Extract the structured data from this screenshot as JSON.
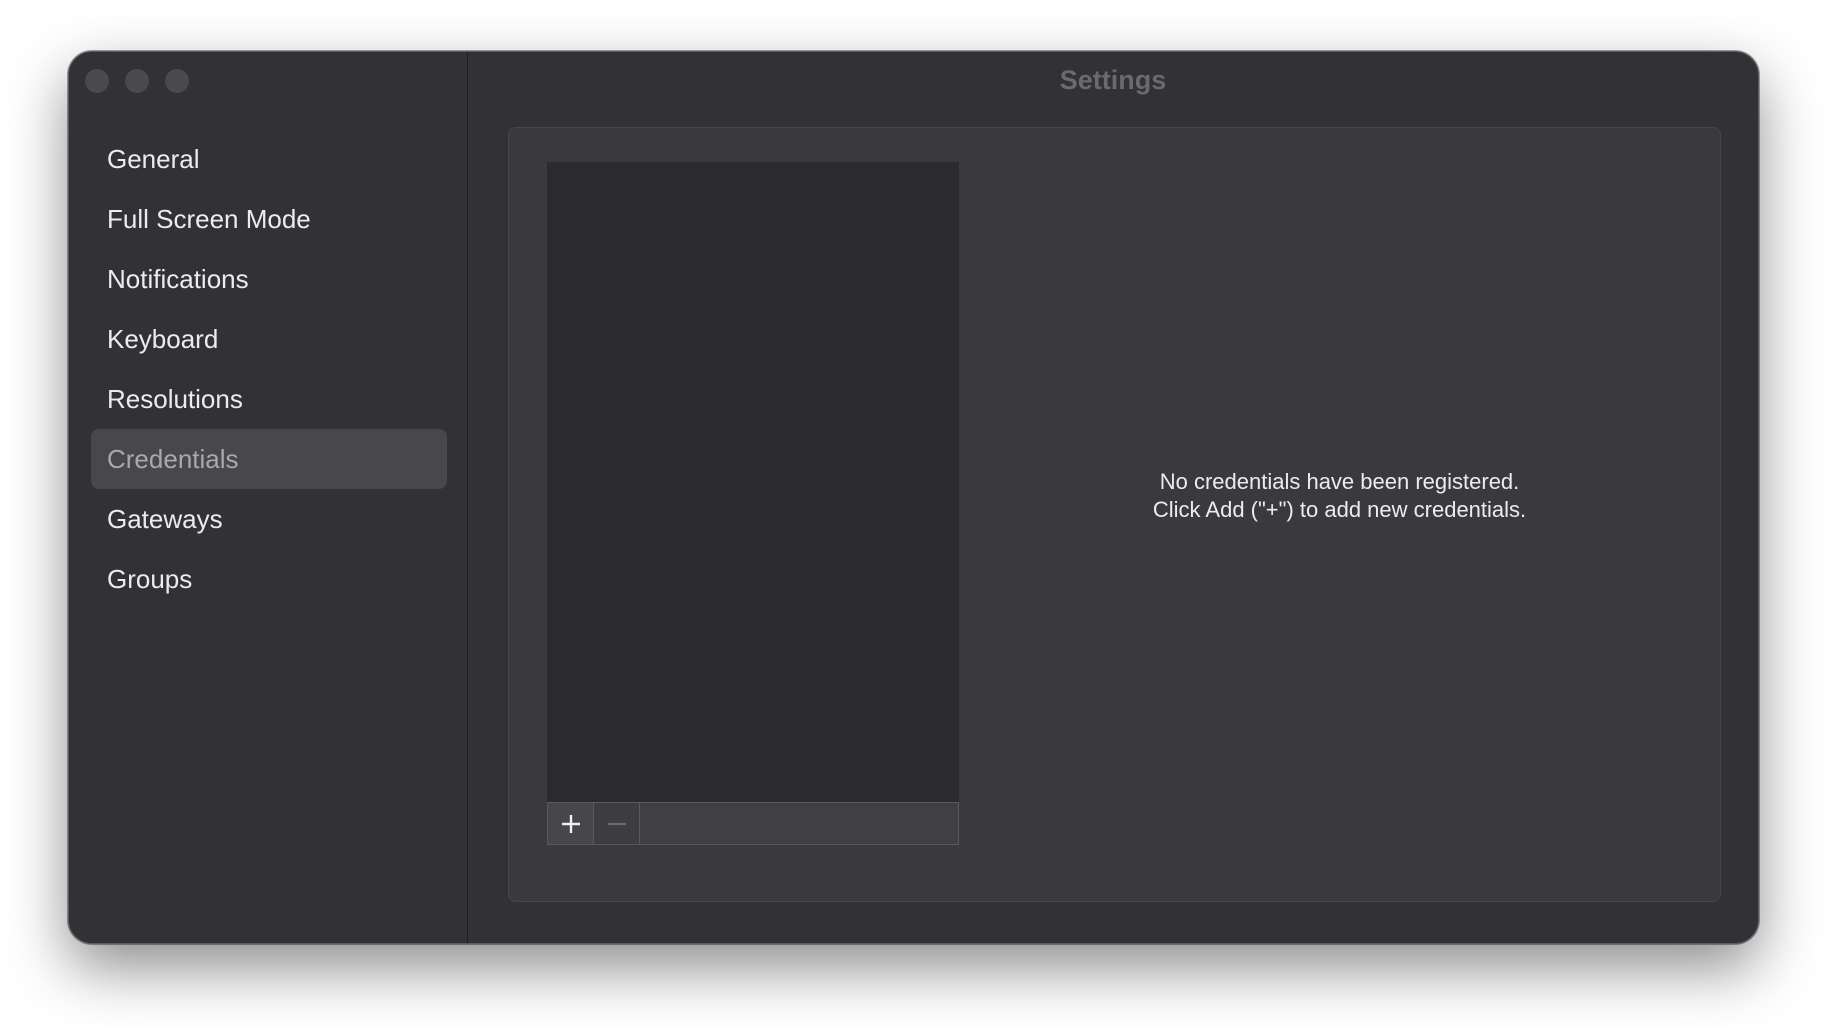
{
  "window": {
    "title": "Settings"
  },
  "sidebar": {
    "items": [
      {
        "label": "General"
      },
      {
        "label": "Full Screen Mode"
      },
      {
        "label": "Notifications"
      },
      {
        "label": "Keyboard"
      },
      {
        "label": "Resolutions"
      },
      {
        "label": "Credentials",
        "selected": true
      },
      {
        "label": "Gateways"
      },
      {
        "label": "Groups"
      }
    ]
  },
  "credentials": {
    "empty_line1": "No credentials have been registered.",
    "empty_line2": "Click Add (\"+\") to add new credentials.",
    "add_icon": "plus-icon",
    "remove_icon": "minus-icon"
  },
  "colors": {
    "window_bg": "#323236",
    "selected_item_bg": "#48484c",
    "content_bg": "#3a3a3e",
    "list_bg": "#2b2b2e"
  }
}
